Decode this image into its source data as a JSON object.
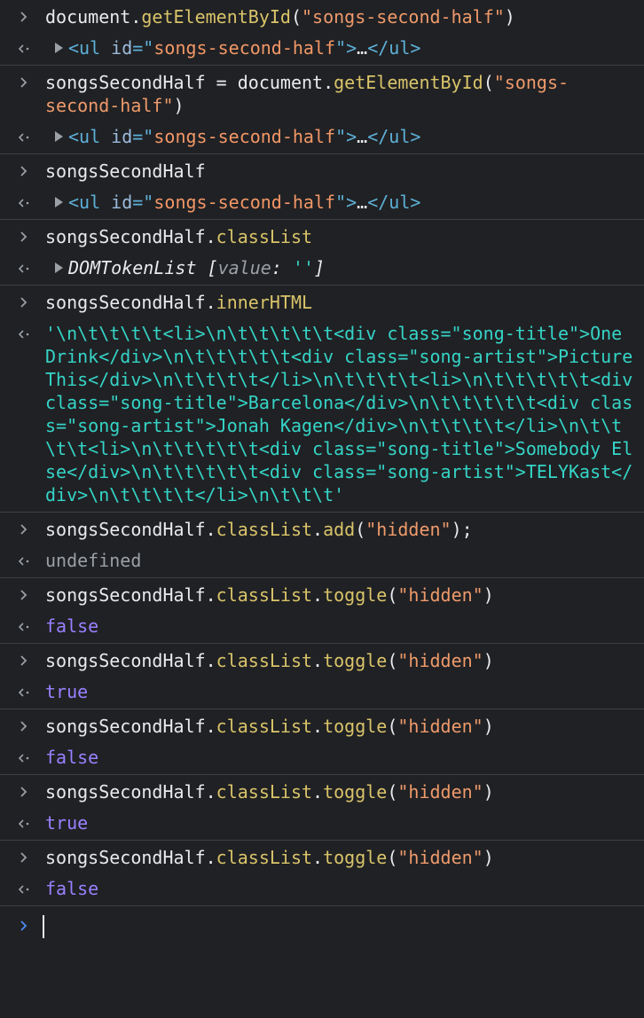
{
  "console": {
    "entries": [
      {
        "input": [
          {
            "t": "document.",
            "c": "plain"
          },
          {
            "t": "getElementById",
            "c": "method"
          },
          {
            "t": "(",
            "c": "plain"
          },
          {
            "t": "\"songs-second-half\"",
            "c": "string"
          },
          {
            "t": ")",
            "c": "plain"
          }
        ],
        "output": [
          {
            "t": "<ul ",
            "c": "tag"
          },
          {
            "t": "id",
            "c": "attr"
          },
          {
            "t": "=\"",
            "c": "tag"
          },
          {
            "t": "songs-second-half",
            "c": "attrval"
          },
          {
            "t": "\">",
            "c": "tag"
          },
          {
            "t": "…",
            "c": "ellip"
          },
          {
            "t": "</ul>",
            "c": "tag"
          }
        ],
        "output_expandable": true
      },
      {
        "input": [
          {
            "t": "songsSecondHalf = document.",
            "c": "plain"
          },
          {
            "t": "getElementById",
            "c": "method"
          },
          {
            "t": "(",
            "c": "plain"
          },
          {
            "t": "\"songs-\nsecond-half\"",
            "c": "string"
          },
          {
            "t": ")",
            "c": "plain"
          }
        ],
        "output": [
          {
            "t": "<ul ",
            "c": "tag"
          },
          {
            "t": "id",
            "c": "attr"
          },
          {
            "t": "=\"",
            "c": "tag"
          },
          {
            "t": "songs-second-half",
            "c": "attrval"
          },
          {
            "t": "\">",
            "c": "tag"
          },
          {
            "t": "…",
            "c": "ellip"
          },
          {
            "t": "</ul>",
            "c": "tag"
          }
        ],
        "output_expandable": true
      },
      {
        "input": [
          {
            "t": "songsSecondHalf",
            "c": "plain"
          }
        ],
        "output": [
          {
            "t": "<ul ",
            "c": "tag"
          },
          {
            "t": "id",
            "c": "attr"
          },
          {
            "t": "=\"",
            "c": "tag"
          },
          {
            "t": "songs-second-half",
            "c": "attrval"
          },
          {
            "t": "\">",
            "c": "tag"
          },
          {
            "t": "…",
            "c": "ellip"
          },
          {
            "t": "</ul>",
            "c": "tag"
          }
        ],
        "output_expandable": true
      },
      {
        "input": [
          {
            "t": "songsSecondHalf.",
            "c": "plain"
          },
          {
            "t": "classList",
            "c": "method"
          }
        ],
        "output": [
          {
            "t": "DOMTokenList",
            "c": "ital"
          },
          {
            "t": " [",
            "c": "ital"
          },
          {
            "t": "value",
            "c": "italgray"
          },
          {
            "t": ": ",
            "c": "ital"
          },
          {
            "t": "''",
            "c": "strout"
          },
          {
            "t": "]",
            "c": "ital"
          }
        ],
        "output_expandable": true
      },
      {
        "input": [
          {
            "t": "songsSecondHalf.",
            "c": "plain"
          },
          {
            "t": "innerHTML",
            "c": "method"
          }
        ],
        "output": [
          {
            "t": "'\\n\\t\\t\\t\\t<li>\\n\\t\\t\\t\\t\\t<div class=\"song-title\">One Drink</div>\\n\\t\\t\\t\\t\\t<div class=\"song-artist\">Picture This</div>\\n\\t\\t\\t\\t</li>\\n\\t\\t\\t\\t<li>\\n\\t\\t\\t\\t\\t<div class=\"song-title\">Barcelona</div>\\n\\t\\t\\t\\t\\t<div class=\"song-artist\">Jonah Kagen</div>\\n\\t\\t\\t\\t</li>\\n\\t\\t\\t\\t<li>\\n\\t\\t\\t\\t\\t<div class=\"song-title\">Somebody Else</div>\\n\\t\\t\\t\\t\\t<div class=\"song-artist\">TELYKast</div>\\n\\t\\t\\t\\t</li>\\n\\t\\t\\t'",
            "c": "strout"
          }
        ],
        "output_expandable": false
      },
      {
        "input": [
          {
            "t": "songsSecondHalf.",
            "c": "plain"
          },
          {
            "t": "classList",
            "c": "method"
          },
          {
            "t": ".",
            "c": "plain"
          },
          {
            "t": "add",
            "c": "method"
          },
          {
            "t": "(",
            "c": "plain"
          },
          {
            "t": "\"hidden\"",
            "c": "string"
          },
          {
            "t": ");",
            "c": "plain"
          }
        ],
        "output": [
          {
            "t": "undefined",
            "c": "undef"
          }
        ],
        "output_expandable": false
      },
      {
        "input": [
          {
            "t": "songsSecondHalf.",
            "c": "plain"
          },
          {
            "t": "classList",
            "c": "method"
          },
          {
            "t": ".",
            "c": "plain"
          },
          {
            "t": "toggle",
            "c": "method"
          },
          {
            "t": "(",
            "c": "plain"
          },
          {
            "t": "\"hidden\"",
            "c": "string"
          },
          {
            "t": ")",
            "c": "plain"
          }
        ],
        "output": [
          {
            "t": "false",
            "c": "bool"
          }
        ],
        "output_expandable": false
      },
      {
        "input": [
          {
            "t": "songsSecondHalf.",
            "c": "plain"
          },
          {
            "t": "classList",
            "c": "method"
          },
          {
            "t": ".",
            "c": "plain"
          },
          {
            "t": "toggle",
            "c": "method"
          },
          {
            "t": "(",
            "c": "plain"
          },
          {
            "t": "\"hidden\"",
            "c": "string"
          },
          {
            "t": ")",
            "c": "plain"
          }
        ],
        "output": [
          {
            "t": "true",
            "c": "bool"
          }
        ],
        "output_expandable": false
      },
      {
        "input": [
          {
            "t": "songsSecondHalf.",
            "c": "plain"
          },
          {
            "t": "classList",
            "c": "method"
          },
          {
            "t": ".",
            "c": "plain"
          },
          {
            "t": "toggle",
            "c": "method"
          },
          {
            "t": "(",
            "c": "plain"
          },
          {
            "t": "\"hidden\"",
            "c": "string"
          },
          {
            "t": ")",
            "c": "plain"
          }
        ],
        "output": [
          {
            "t": "false",
            "c": "bool"
          }
        ],
        "output_expandable": false
      },
      {
        "input": [
          {
            "t": "songsSecondHalf.",
            "c": "plain"
          },
          {
            "t": "classList",
            "c": "method"
          },
          {
            "t": ".",
            "c": "plain"
          },
          {
            "t": "toggle",
            "c": "method"
          },
          {
            "t": "(",
            "c": "plain"
          },
          {
            "t": "\"hidden\"",
            "c": "string"
          },
          {
            "t": ")",
            "c": "plain"
          }
        ],
        "output": [
          {
            "t": "true",
            "c": "bool"
          }
        ],
        "output_expandable": false
      },
      {
        "input": [
          {
            "t": "songsSecondHalf.",
            "c": "plain"
          },
          {
            "t": "classList",
            "c": "method"
          },
          {
            "t": ".",
            "c": "plain"
          },
          {
            "t": "toggle",
            "c": "method"
          },
          {
            "t": "(",
            "c": "plain"
          },
          {
            "t": "\"hidden\"",
            "c": "string"
          },
          {
            "t": ")",
            "c": "plain"
          }
        ],
        "output": [
          {
            "t": "false",
            "c": "bool"
          }
        ],
        "output_expandable": false
      }
    ],
    "prompt_value": ""
  },
  "colors": {
    "background": "#202124",
    "divider": "#3c4043",
    "prompt_active": "#4c8df6",
    "glyph": "#9aa0a6"
  },
  "icons": {
    "input_prompt": "chevron-right-icon",
    "output_marker": "return-arrow-icon",
    "expand": "disclosure-triangle-icon"
  }
}
